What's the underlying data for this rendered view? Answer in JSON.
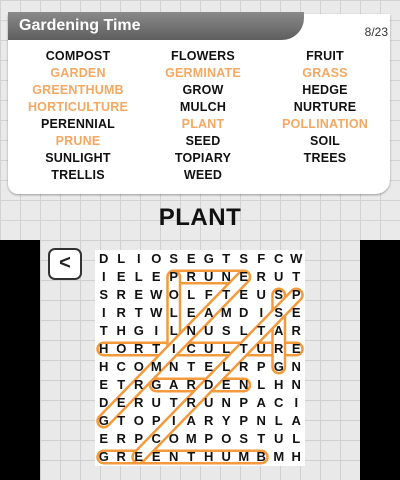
{
  "header": {
    "title": "Gardening Time",
    "progress": "8/23"
  },
  "current_word": "PLANT",
  "words": [
    {
      "text": "COMPOST",
      "found": false
    },
    {
      "text": "FLOWERS",
      "found": false
    },
    {
      "text": "FRUIT",
      "found": false
    },
    {
      "text": "GARDEN",
      "found": true
    },
    {
      "text": "GERMINATE",
      "found": true
    },
    {
      "text": "GRASS",
      "found": true
    },
    {
      "text": "GREENTHUMB",
      "found": true
    },
    {
      "text": "GROW",
      "found": false
    },
    {
      "text": "HEDGE",
      "found": false
    },
    {
      "text": "HORTICULTURE",
      "found": true
    },
    {
      "text": "MULCH",
      "found": false
    },
    {
      "text": "NURTURE",
      "found": false
    },
    {
      "text": "PERENNIAL",
      "found": false
    },
    {
      "text": "PLANT",
      "found": true
    },
    {
      "text": "POLLINATION",
      "found": true
    },
    {
      "text": "PRUNE",
      "found": true
    },
    {
      "text": "SEED",
      "found": false
    },
    {
      "text": "SOIL",
      "found": false
    },
    {
      "text": "SUNLIGHT",
      "found": false
    },
    {
      "text": "TOPIARY",
      "found": false
    },
    {
      "text": "TREES",
      "found": false
    },
    {
      "text": "TRELLIS",
      "found": false
    },
    {
      "text": "WEED",
      "found": false
    }
  ],
  "back_button": {
    "label": "<"
  },
  "grid": [
    "DLIOSEGTSFCW",
    "IELEPRUNERUT",
    "SREWOLFTEUSP",
    "IRTWLEAMDISE",
    "THGILNUSLTAR",
    "HORTICULTURE",
    "HCOMNTELRPGN",
    "ETRGARDENLHN",
    "DERUTRUNPACI",
    "GTOPIARYPNLA",
    "ERPCOMPOSTUL",
    "GREENTHUMBMH"
  ],
  "highlight_color": "#f39a3c",
  "found_lines": [
    {
      "word": "PRUNE",
      "from": [
        1,
        4
      ],
      "to": [
        1,
        8
      ]
    },
    {
      "word": "HORTICULTURE",
      "from": [
        5,
        0
      ],
      "to": [
        5,
        11
      ]
    },
    {
      "word": "GREENTHUMB",
      "from": [
        11,
        0
      ],
      "to": [
        11,
        9
      ]
    },
    {
      "word": "GARDEN",
      "from": [
        7,
        3
      ],
      "to": [
        7,
        8
      ]
    },
    {
      "word": "PLANT",
      "from": [
        1,
        4
      ],
      "to": [
        5,
        4
      ]
    },
    {
      "word": "GERMINATE",
      "from": [
        9,
        0
      ],
      "to": [
        1,
        8
      ]
    },
    {
      "word": "GRASS",
      "from": [
        6,
        10
      ],
      "to": [
        2,
        10
      ]
    },
    {
      "word": "POLLINATION",
      "from": [
        2,
        11
      ],
      "to": [
        11,
        2
      ]
    }
  ]
}
